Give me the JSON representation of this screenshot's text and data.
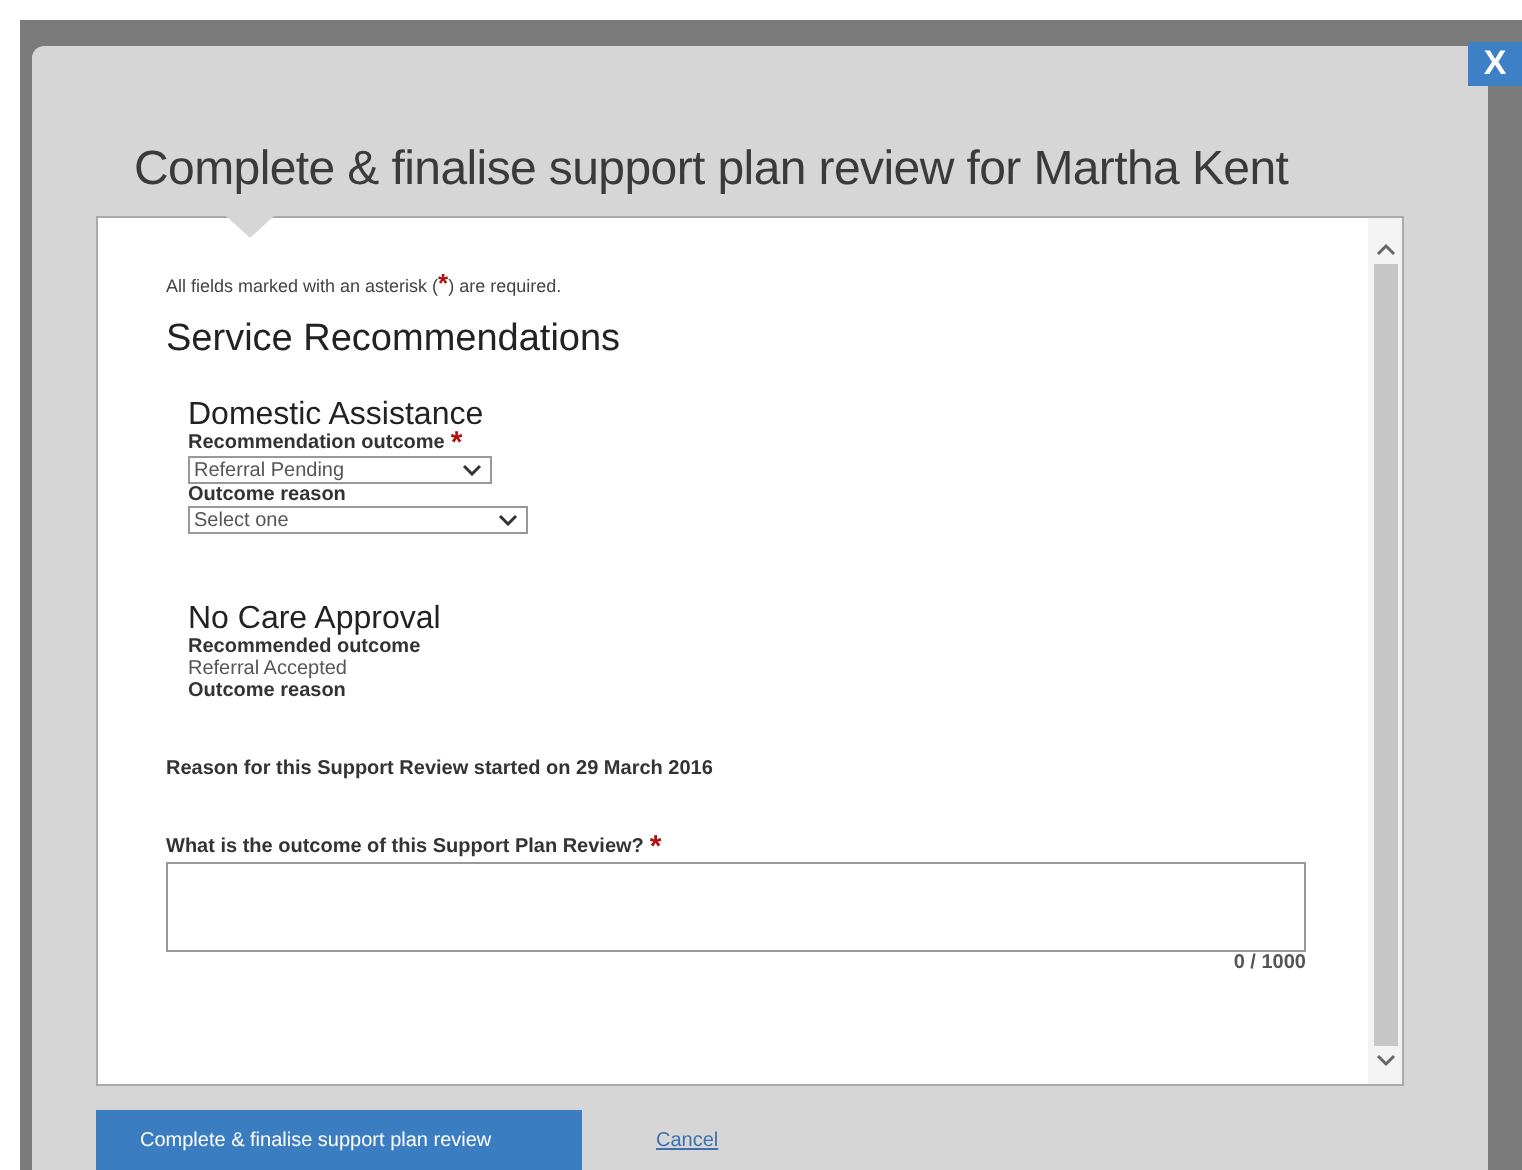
{
  "close_button": {
    "label": "X"
  },
  "title": "Complete & finalise support plan review for Martha Kent",
  "required_note": {
    "before": "All fields marked with an asterisk (",
    "mark": "*",
    "after": ") are required."
  },
  "heading": "Service Recommendations",
  "services": [
    {
      "kind": "select",
      "name": "Domestic Assistance",
      "fields": [
        {
          "label": "Recommendation outcome",
          "required_mark": "*",
          "value": "Referral Pending",
          "wide": false
        },
        {
          "label": "Outcome reason",
          "value": "Select one",
          "wide": true
        }
      ]
    },
    {
      "kind": "readonly",
      "name": "No Care Approval",
      "fields": [
        {
          "label": "Recommended outcome",
          "value": "Referral Accepted"
        },
        {
          "label": "Outcome reason"
        }
      ]
    }
  ],
  "reason_text": "Reason for this Support Review started on 29 March 2016",
  "outcome_question": {
    "label": "What is the outcome of this Support Plan Review?",
    "required_mark": "*",
    "counter": "0 / 1000"
  },
  "primary_button": "Complete & finalise support plan review",
  "cancel_link": "Cancel"
}
